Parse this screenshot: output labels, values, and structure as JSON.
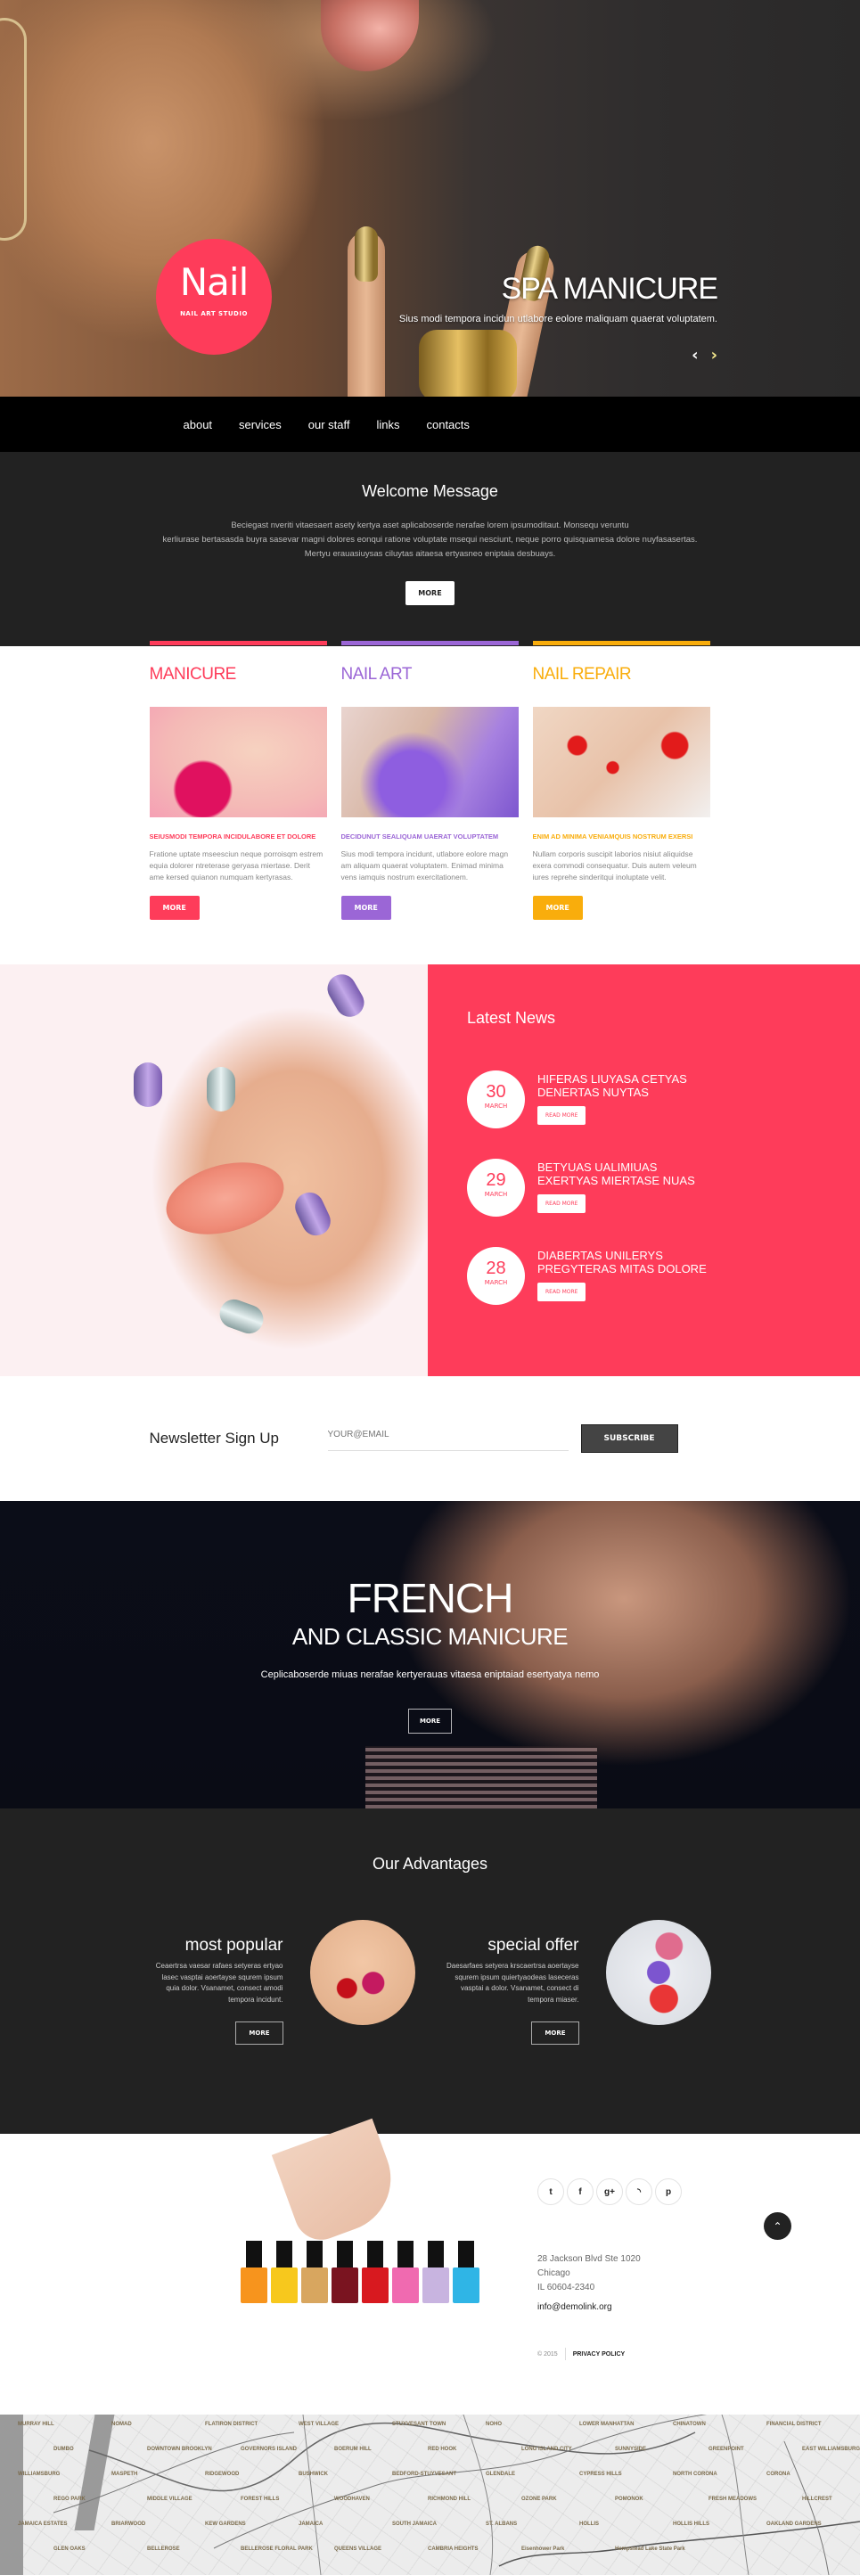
{
  "brand": {
    "name": "Nail",
    "tagline": "NAIL ART STUDIO",
    "accent": "#fe3c5a"
  },
  "hero": {
    "title": "SPA MANICURE",
    "text": "Sius modi tempora incidun utlabore eolore maliquam quaerat voluptatem.",
    "prev_icon": "‹",
    "next_icon": "›"
  },
  "nav": {
    "items": [
      "about",
      "services",
      "our staff",
      "links",
      "contacts"
    ]
  },
  "welcome": {
    "title": "Welcome Message",
    "lines": [
      "Beciegast nveriti vitaesaert asety kertya aset aplicaboserde nerafae lorem ipsumoditaut. Monsequ veruntu",
      "kerliurase bertasasda buyra sasevar magni dolores eonqui ratione voluptate msequi nesciunt, neque porro quisquamesa dolore nuyfasasertas.",
      "Mertyu erauasiuysas ciluytas aitaesa ertyasneo eniptaia desbuays."
    ],
    "button": "MORE"
  },
  "services": [
    {
      "title": "MANICURE",
      "color": "#fe3c5a",
      "subtitle": "SEIUSMODI TEMPORA INCIDULABORE ET DOLORE",
      "desc": "Fratione uptate mseesciun neque porroisqm estrem equia dolorer ntreterase geryasa miertase. Derit ame kersed quianon numquam kertyrasas.",
      "button": "MORE"
    },
    {
      "title": "NAIL ART",
      "color": "#9b66d6",
      "subtitle": "DECIDUNUT SEALIQUAM UAERAT VOLUPTATEM",
      "desc": "Sius modi tempora incidunt, utlabore eolore magn am aliquam quaerat voluptatem. Enimad minima vens iamquis nostrum exercitationem.",
      "button": "MORE"
    },
    {
      "title": "NAIL REPAIR",
      "color": "#f9ad0c",
      "subtitle": "ENIM AD MINIMA VENIAMQUIS NOSTRUM EXERSI",
      "desc": "Nullam corporis suscipit laborios nisiut aliquidse exera commodi consequatur. Duis autem veleum iures reprehe sinderitqui inoluptate velit.",
      "button": "MORE"
    }
  ],
  "news": {
    "title": "Latest News",
    "items": [
      {
        "day": "30",
        "month": "MARCH",
        "title": "HIFERAS LIUYASA CETYAS DENERTAS NUYTAS",
        "button": "READ MORE"
      },
      {
        "day": "29",
        "month": "MARCH",
        "title": "BETYUAS UALIMIUAS EXERTYAS MIERTASE NUAS",
        "button": "READ MORE"
      },
      {
        "day": "28",
        "month": "MARCH",
        "title": "DIABERTAS UNILERYS PREGYTERAS MITAS DOLORE",
        "button": "READ MORE"
      }
    ]
  },
  "newsletter": {
    "title": "Newsletter Sign Up",
    "placeholder": "YOUR@EMAIL",
    "button": "SUBSCRIBE"
  },
  "french": {
    "title": "FRENCH",
    "subtitle": "AND CLASSIC MANICURE",
    "text": "Ceplicaboserde miuas nerafae kertyerauas vitaesa eniptaiad esertyatya nemo",
    "button": "MORE"
  },
  "advantages": {
    "title": "Our Advantages",
    "items": [
      {
        "title": "most popular",
        "text": "Ceaertrsa vaesar rafaes setyeras ertyao lasec vasptai aoertayse squrem ipsum quia dolor. Vsanamet, consect amodi tempora incidunt.",
        "button": "MORE"
      },
      {
        "title": "special offer",
        "text": "Daesarfaes setyera krscaertrsa aoertayse squrem ipsum quiertyaodeas laseceras vasptai a dolor. Vsanamet, consect di tempora miaser.",
        "button": "MORE"
      }
    ]
  },
  "footer": {
    "social": [
      {
        "name": "twitter-icon",
        "glyph": "t"
      },
      {
        "name": "facebook-icon",
        "glyph": "f"
      },
      {
        "name": "google-plus-icon",
        "glyph": "g+"
      },
      {
        "name": "rss-icon",
        "glyph": "◝"
      },
      {
        "name": "pinterest-icon",
        "glyph": "p"
      }
    ],
    "address": [
      "28 Jackson Blvd Ste 1020",
      "Chicago",
      "IL 60604-2340"
    ],
    "email": "info@demolink.org",
    "copyright": "© 2015",
    "privacy": "PRIVACY POLICY",
    "to_top_icon": "⌃",
    "bottle_colors": [
      "#f7941d",
      "#f7c81d",
      "#d8a65f",
      "#7a1420",
      "#d8191f",
      "#f06ab0",
      "#c8b4e0",
      "#2fb5e6"
    ]
  },
  "map": {
    "labels": [
      "MURRAY HILL",
      "NOMAD",
      "FLATIRON DISTRICT",
      "WEST VILLAGE",
      "STUYVESANT TOWN",
      "NOHO",
      "LOWER MANHATTAN",
      "CHINATOWN",
      "FINANCIAL DISTRICT",
      "DUMBO",
      "DOWNTOWN BROOKLYN",
      "GOVERNORS ISLAND",
      "BOERUM HILL",
      "RED HOOK",
      "LONG ISLAND CITY",
      "SUNNYSIDE",
      "GREENPOINT",
      "EAST WILLIAMSBURG",
      "WILLIAMSBURG",
      "MASPETH",
      "RIDGEWOOD",
      "BUSHWICK",
      "BEDFORD-STUYVESANT",
      "GLENDALE",
      "CYPRESS HILLS",
      "NORTH CORONA",
      "CORONA",
      "REGO PARK",
      "MIDDLE VILLAGE",
      "FOREST HILLS",
      "WOODHAVEN",
      "RICHMOND HILL",
      "OZONE PARK",
      "POMONOK",
      "FRESH MEADOWS",
      "HILLCREST",
      "JAMAICA ESTATES",
      "BRIARWOOD",
      "KEW GARDENS",
      "JAMAICA",
      "SOUTH JAMAICA",
      "ST. ALBANS",
      "HOLLIS",
      "HOLLIS HILLS",
      "OAKLAND GARDENS",
      "GLEN OAKS",
      "BELLEROSE",
      "BELLEROSE FLORAL PARK",
      "QUEENS VILLAGE",
      "CAMBRIA HEIGHTS",
      "Eisenhower Park",
      "Hempstead Lake State Park"
    ]
  }
}
